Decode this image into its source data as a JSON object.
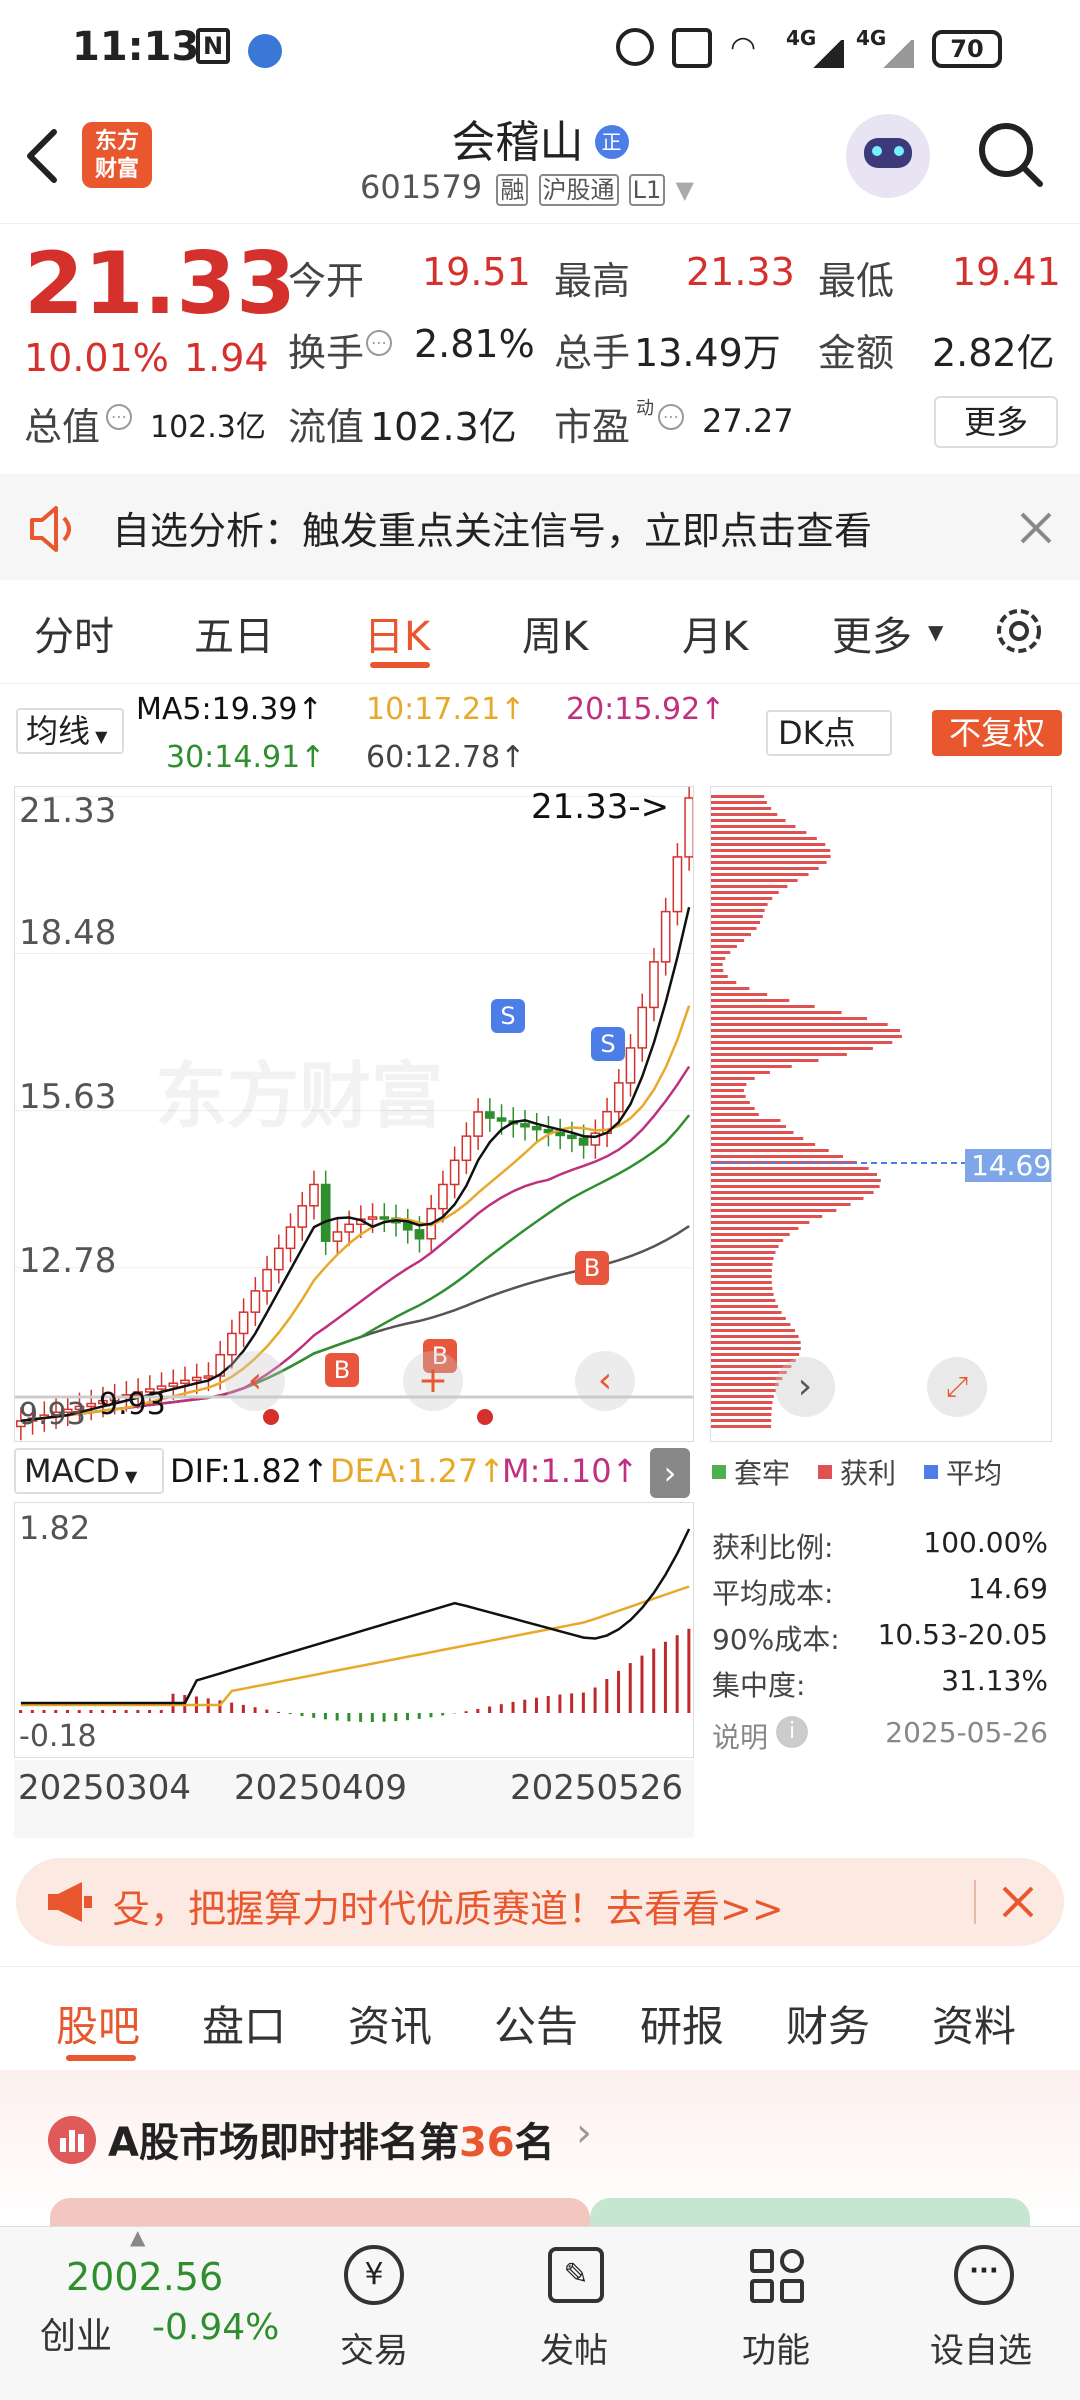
{
  "status_bar": {
    "time": "11:13",
    "battery": "70",
    "net1": "4G",
    "net2": "4G"
  },
  "header": {
    "logo_line1": "东方",
    "logo_line2": "财富",
    "title": "会稽山",
    "title_badge": "正",
    "code": "601579",
    "tag_rong": "融",
    "tag_hugutong": "沪股通",
    "tag_level": "L1"
  },
  "quote": {
    "price": "21.33",
    "change_pct": "10.01%",
    "change": "1.94",
    "open_label": "今开",
    "open": "19.51",
    "high_label": "最高",
    "high": "21.33",
    "low_label": "最低",
    "low": "19.41",
    "turnover_label": "换手",
    "turnover": "2.81%",
    "volume_label": "总手",
    "volume": "13.49万",
    "amount_label": "金额",
    "amount": "2.82亿",
    "mktcap_label": "总值",
    "mktcap": "102.3亿",
    "float_label": "流值",
    "float_cap": "102.3亿",
    "pe_label": "市盈",
    "pe_sup": "动",
    "pe": "27.27",
    "more_button": "更多"
  },
  "alert": {
    "text": "自选分析：触发重点关注信号，立即点击查看"
  },
  "chart_tabs": {
    "items": [
      "分时",
      "五日",
      "日K",
      "周K",
      "月K",
      "更多"
    ],
    "active": 2
  },
  "ma_bar": {
    "selector": "均线",
    "ma5": "MA5:19.39↑",
    "ma10": "10:17.21↑",
    "ma20": "20:15.92↑",
    "ma30": "30:14.91↑",
    "ma60": "60:12.78↑",
    "dk_button": "DK点",
    "adjust_button": "不复权"
  },
  "colors": {
    "up": "#d4312c",
    "down": "#2f8f2f",
    "ma5": "#111111",
    "ma10": "#e8a92b",
    "ma20": "#c0307e",
    "ma30": "#2f8f2f",
    "ma60": "#555555",
    "accent": "#e8572d"
  },
  "kchart": {
    "y_ticks": [
      "21.33",
      "18.48",
      "15.63",
      "12.78",
      "9.93"
    ],
    "last_label": "21.33->",
    "low_label": "9.93",
    "watermark": "东方财富"
  },
  "macd_bar": {
    "selector": "MACD",
    "dif": "DIF:1.82↑",
    "dea": "DEA:1.27↑",
    "m": "M:1.10↑",
    "y_top": "1.82",
    "y_bottom": "-0.18"
  },
  "x_axis": [
    "20250304",
    "20250409",
    "20250526"
  ],
  "chips": {
    "level_label": "14.69",
    "legend": [
      "套牢",
      "获利",
      "平均"
    ],
    "stats": [
      {
        "label": "获利比例:",
        "value": "100.00%"
      },
      {
        "label": "平均成本:",
        "value": "14.69"
      },
      {
        "label": "90%成本:",
        "value": "10.53-20.05"
      },
      {
        "label": "集中度:",
        "value": "31.13%"
      }
    ],
    "note_label": "说明",
    "date": "2025-05-26"
  },
  "promo": {
    "text": "殳，把握算力时代优质赛道！去看看>>"
  },
  "bottom_tabs": {
    "items": [
      "股吧",
      "盘口",
      "资讯",
      "公告",
      "研报",
      "财务",
      "资料"
    ],
    "active": 0
  },
  "ranking": {
    "prefix": "A股市场即时排名第",
    "rank": "36",
    "suffix": "名"
  },
  "bottom_nav": {
    "index_value": "2002.56",
    "index_name": "创业",
    "index_change": "-0.94%",
    "items": [
      {
        "label": "交易",
        "icon": "yuan-exchange-icon"
      },
      {
        "label": "发帖",
        "icon": "edit-icon"
      },
      {
        "label": "功能",
        "icon": "grid-icon"
      },
      {
        "label": "设自选",
        "icon": "more-circle-icon"
      }
    ]
  }
}
